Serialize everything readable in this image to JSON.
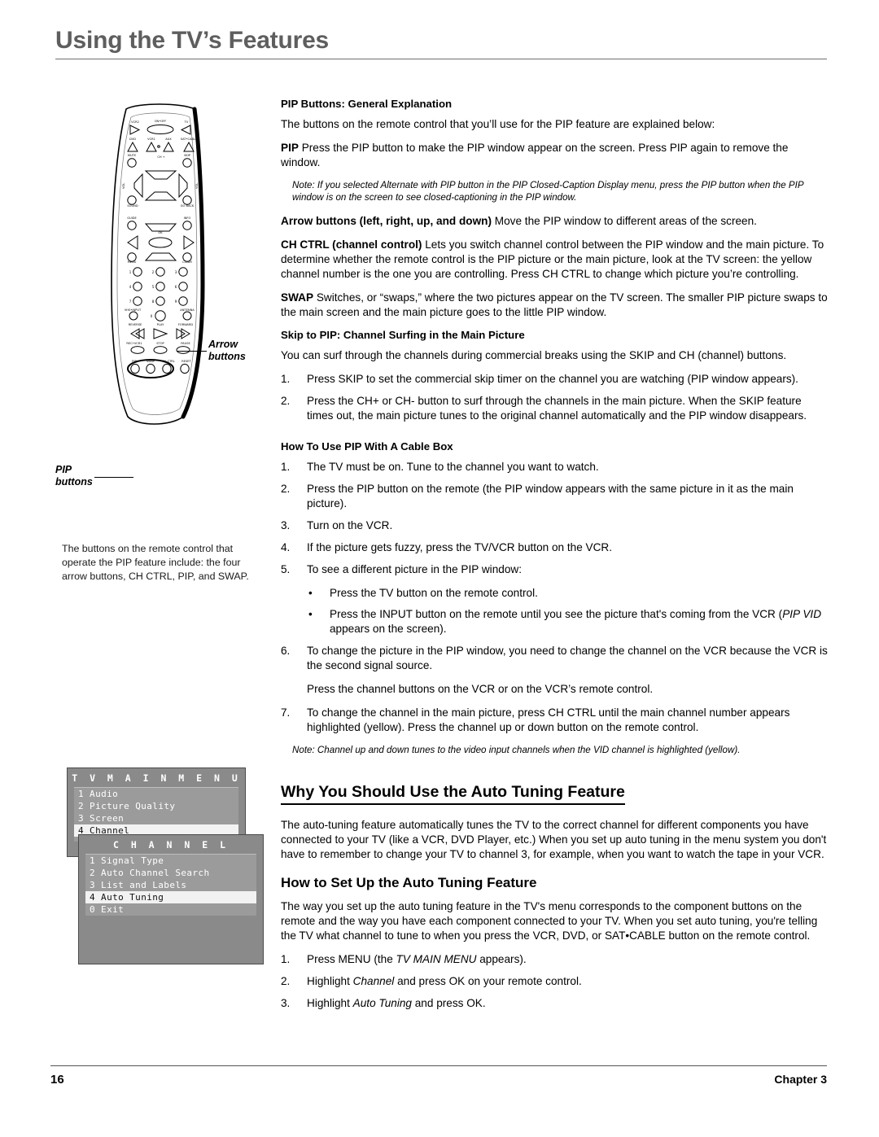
{
  "header": {
    "title": "Using the TV’s Features"
  },
  "left": {
    "callouts": {
      "arrow": "Arrow\nbuttons",
      "arrow_l1": "Arrow",
      "arrow_l2": "buttons",
      "pip_l1": "PIP",
      "pip_l2": "buttons"
    },
    "caption": "The buttons on the remote control that operate the PIP feature include: the four arrow buttons, CH CTRL, PIP, and SWAP.",
    "remote_labels": {
      "row1": [
        "VCR2",
        "ON•OFF",
        "TV"
      ],
      "row2": [
        "DVD",
        "VCR1",
        "AUX",
        "SAT•CABLE"
      ],
      "row3": [
        "MUTE",
        "CH +",
        "SKIP"
      ],
      "row4": [
        "VOL",
        "VOL"
      ],
      "row5": [
        "SOUND",
        "CH –",
        "GO BACK"
      ],
      "row6": [
        "GUIDE",
        "INFO"
      ],
      "row7": [
        "OK"
      ],
      "row8": [
        "MENU",
        "CLEAR"
      ],
      "numbers": [
        "1",
        "2",
        "3",
        "4",
        "5",
        "6",
        "7",
        "8",
        "9",
        "0"
      ],
      "row9": [
        "VHS•INPUT",
        "ANTENNA"
      ],
      "row10": [
        "REVERSE",
        "PLAY",
        "FORWARD"
      ],
      "row11": [
        "REC•VCR1",
        "STOP",
        "PAUSE"
      ],
      "row12": [
        "PIP",
        "SWAP",
        "CH CTRL",
        "RESET"
      ]
    }
  },
  "osd": {
    "main": {
      "title": "T V   M A I N   M E N U",
      "items": [
        {
          "label": "1 Audio",
          "selected": false
        },
        {
          "label": "2 Picture Quality",
          "selected": false
        },
        {
          "label": "3 Screen",
          "selected": false
        },
        {
          "label": "4 Channel",
          "selected": true
        }
      ]
    },
    "sub": {
      "title": "C H A N N E L",
      "items": [
        {
          "label": "1 Signal Type",
          "selected": false
        },
        {
          "label": "2 Auto Channel Search",
          "selected": false
        },
        {
          "label": "3 List and Labels",
          "selected": false
        },
        {
          "label": "4 Auto Tuning",
          "selected": true
        },
        {
          "label": "0 Exit",
          "selected": false
        }
      ]
    }
  },
  "main": {
    "s1_heading": "PIP Buttons: General Explanation",
    "s1_intro": "The buttons on the remote control that you’ll use for the PIP feature are explained below:",
    "pip_lead": "PIP",
    "pip_text": "Press the PIP button to make the PIP window appear on the screen. Press PIP again to remove the window.",
    "note1": "Note: If you selected Alternate with PIP button in the PIP Closed-Caption Display menu, press the PIP button when the PIP window is on the screen to see closed-captioning in the PIP window.",
    "arrow_lead": "Arrow buttons (left, right, up, and down)",
    "arrow_text": "Move the PIP window to different areas of the screen.",
    "chctrl_lead": "CH CTRL (channel control)",
    "chctrl_text": "Lets you switch channel control between the PIP window and the main picture. To determine whether the remote control is the PIP picture or the main picture, look at the TV screen: the yellow channel number is the one you are controlling. Press CH CTRL to change which picture you’re controlling.",
    "swap_lead": "SWAP",
    "swap_text": "Switches, or “swaps,” where the two pictures appear on the TV screen. The smaller PIP picture swaps to the main screen and the main picture goes to the little PIP window.",
    "s2_heading": "Skip to PIP: Channel Surfing in the Main Picture",
    "s2_intro": "You can surf through the channels during commercial breaks using the SKIP and CH (channel) buttons.",
    "s2_steps": [
      {
        "n": "1.",
        "text": "Press SKIP to set the commercial skip timer on the channel you are watching (PIP window appears)."
      },
      {
        "n": "2.",
        "text": "Press the CH+ or CH- button to surf through the channels in the main picture. When the SKIP feature times out, the main picture tunes to the original channel automatically and the PIP window disappears."
      }
    ],
    "s3_heading": "How To Use PIP With A Cable Box",
    "s3_steps": [
      {
        "n": "1.",
        "text": "The TV must be on. Tune to the channel you want to watch."
      },
      {
        "n": "2.",
        "text": "Press the PIP button on the remote (the PIP window appears with the same picture in it as the main picture)."
      },
      {
        "n": "3.",
        "text": "Turn on the VCR."
      },
      {
        "n": "4.",
        "text": "If the picture gets fuzzy, press the TV/VCR button on the VCR."
      },
      {
        "n": "5.",
        "text": "To see a different picture in the PIP window:"
      }
    ],
    "s3_bullets": [
      {
        "dot": "•",
        "text": "Press the TV button on the remote control."
      },
      {
        "dot": "•",
        "text_pre": "Press the INPUT button on the remote until you see the picture that's coming from the VCR (",
        "text_ital": "PIP VID",
        "text_post": " appears on the screen)."
      }
    ],
    "s3_step6": {
      "n": "6.",
      "text": "To change the picture in the PIP window, you need to change the channel on the VCR because the VCR is the second signal source."
    },
    "s3_step6_extra": "Press the channel buttons on the VCR or on the VCR’s remote control.",
    "s3_step7": {
      "n": "7.",
      "text": "To change the channel in the main picture, press CH CTRL until the main channel number appears highlighted (yellow). Press the channel up or down button on the remote control."
    },
    "note2": "Note: Channel up and down tunes to the video input channels when the VID channel is highlighted (yellow).",
    "h_why": "Why You Should Use the Auto Tuning Feature",
    "why_text": "The auto-tuning feature automatically tunes the TV to the correct channel for different components you have connected to your TV (like a VCR, DVD Player, etc.) When you set up auto tuning in the menu system you don't have to remember to change your TV to channel 3, for example, when you want to watch the tape in your VCR.",
    "h_how": "How to Set Up the Auto Tuning Feature",
    "how_text": "The way you set up the auto tuning feature in the TV's menu corresponds to the component buttons on the remote and the way you have each component connected to your TV. When you set auto tuning, you're telling the TV what channel to tune to when you press the VCR, DVD, or SAT•CABLE button on the remote control.",
    "how_steps": [
      {
        "n": "1.",
        "pre": "Press MENU (the ",
        "ital": "TV MAIN MENU",
        "post": " appears)."
      },
      {
        "n": "2.",
        "pre": "Highlight ",
        "ital": "Channel",
        "post": " and press OK on your remote control."
      },
      {
        "n": "3.",
        "pre": "Highlight ",
        "ital": "Auto Tuning",
        "post": " and press OK."
      }
    ]
  },
  "footer": {
    "page": "16",
    "chapter": "Chapter  3"
  }
}
